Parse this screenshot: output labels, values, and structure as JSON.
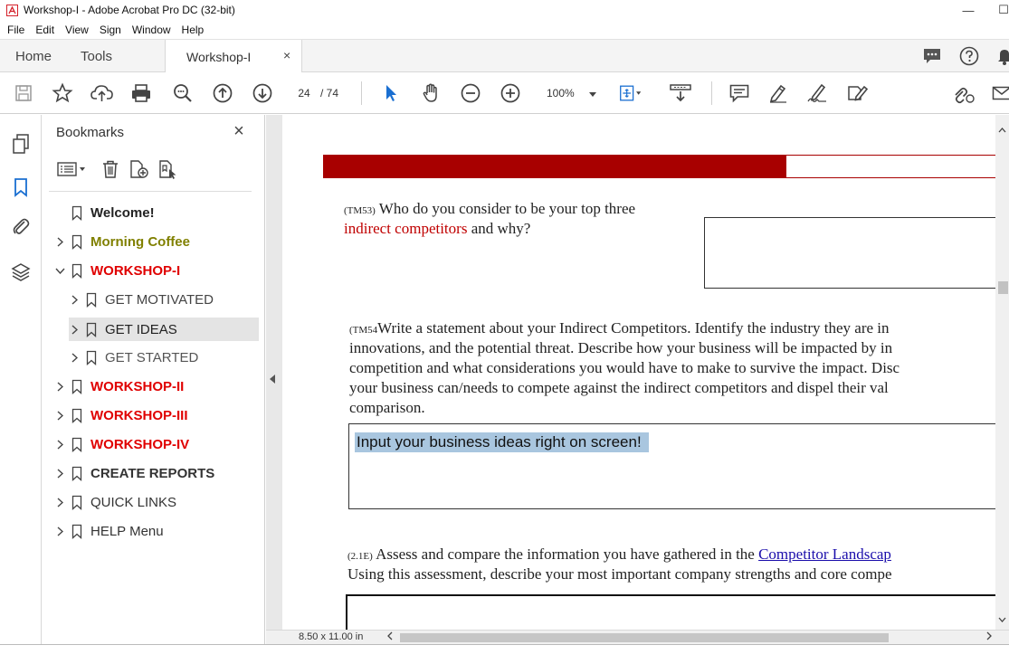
{
  "window": {
    "title": "Workshop-I - Adobe Acrobat Pro DC (32-bit)",
    "minimize_glyph": "—",
    "maximize_glyph": "☐"
  },
  "menu": [
    "File",
    "Edit",
    "View",
    "Sign",
    "Window",
    "Help"
  ],
  "tabs": {
    "home": "Home",
    "tools": "Tools",
    "document": "Workshop-I",
    "close_glyph": "×"
  },
  "toolbar": {
    "current_page": "24",
    "page_total": "/ 74",
    "zoom": "100%"
  },
  "bookmarks": {
    "header": "Bookmarks",
    "close_glyph": "×",
    "items": [
      {
        "label": "Welcome!",
        "color": "#222222",
        "bold": true
      },
      {
        "label": "Morning Coffee",
        "color": "#808000",
        "bold": true
      },
      {
        "label": "WORKSHOP-I",
        "color": "#e00000",
        "bold": true
      },
      {
        "label": "GET MOTIVATED",
        "color": "#444444",
        "bold": false
      },
      {
        "label": "GET IDEAS",
        "color": "#222222",
        "bold": false
      },
      {
        "label": "GET STARTED",
        "color": "#555555",
        "bold": false
      },
      {
        "label": "WORKSHOP-II",
        "color": "#e00000",
        "bold": true
      },
      {
        "label": "WORKSHOP-III",
        "color": "#e00000",
        "bold": true
      },
      {
        "label": "WORKSHOP-IV",
        "color": "#e00000",
        "bold": true
      },
      {
        "label": "CREATE REPORTS",
        "color": "#333333",
        "bold": true
      },
      {
        "label": "QUICK LINKS",
        "color": "#333333",
        "bold": false
      },
      {
        "label": "HELP Menu",
        "color": "#333333",
        "bold": false
      }
    ]
  },
  "document": {
    "q53": {
      "tag": "(TM53)",
      "line1": "Who do you consider to be your top three",
      "highlight": "indirect competitors",
      "line2_rest": " and why?"
    },
    "q54": {
      "tag": "(TM54",
      "line1": "Write a statement about your Indirect Competitors. Identify the industry they are in",
      "line2": "innovations, and the potential threat. Describe how your business will be impacted by in",
      "line3": "competition and what considerations you would have to make to survive the impact. Disc",
      "line4": "your business can/needs to compete against the indirect competitors and dispel their val",
      "line5": "comparison."
    },
    "input_hint": "Input your business ideas right on screen!",
    "q21e": {
      "tag": "(2.1E)",
      "line1_pre": "Assess and compare the information you have gathered in the ",
      "link": "Competitor Landscap",
      "line2": "Using this assessment, describe your most important company strengths and core compe"
    }
  },
  "status": {
    "page_size": "8.50 x 11.00 in"
  }
}
